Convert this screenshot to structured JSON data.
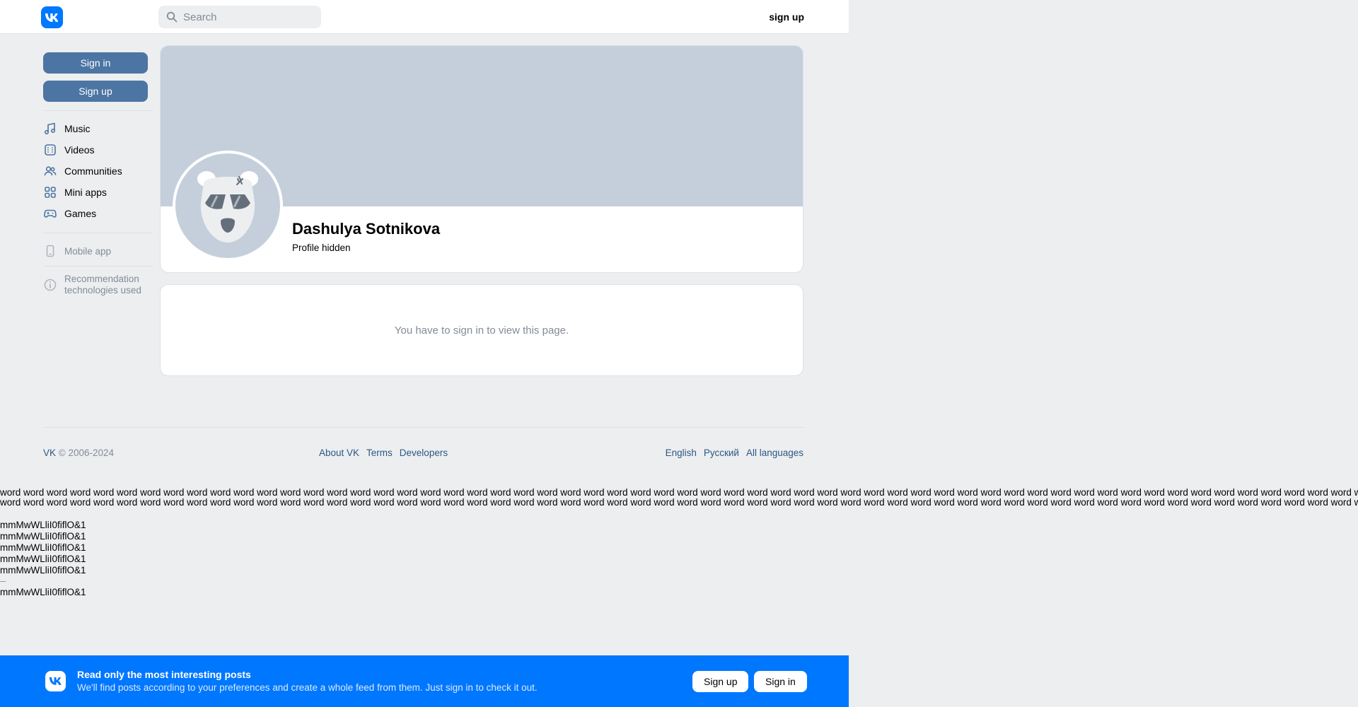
{
  "header": {
    "logo_icon": "vk-logo-icon",
    "search_placeholder": "Search",
    "signup_label": "sign up"
  },
  "sidebar": {
    "signin_label": "Sign in",
    "signup_label": "Sign up",
    "items": [
      {
        "label": "Music",
        "icon": "music-note-icon"
      },
      {
        "label": "Videos",
        "icon": "video-icon"
      },
      {
        "label": "Communities",
        "icon": "users-icon"
      },
      {
        "label": "Mini apps",
        "icon": "grid-icon"
      },
      {
        "label": "Games",
        "icon": "gamepad-icon"
      }
    ],
    "mobile_app_label": "Mobile app",
    "recommendation_label": "Recommendation technologies used"
  },
  "profile": {
    "name": "Dashulya Sotnikova",
    "status": "Profile hidden"
  },
  "info": {
    "message": "You have to sign in to view this page."
  },
  "footer": {
    "copyright_vk": "VK",
    "copyright_rest": " © 2006-2024",
    "links": [
      "About VK",
      "Terms",
      "Developers"
    ],
    "languages": [
      "English",
      "Русский",
      "All languages"
    ]
  },
  "test_text": {
    "word": "word",
    "mm_line": "mmMwWLliI0fiflO&1"
  },
  "banner": {
    "title": "Read only the most interesting posts",
    "subtitle": "We'll find posts according to your preferences and create a whole feed from them. Just sign in to check it out.",
    "signup_label": "Sign up",
    "signin_label": "Sign in"
  },
  "colors": {
    "brand": "#0077ff",
    "button": "#4c75a3",
    "link": "#2a5885",
    "cover": "#c5cfdb",
    "background": "#edeef0"
  }
}
